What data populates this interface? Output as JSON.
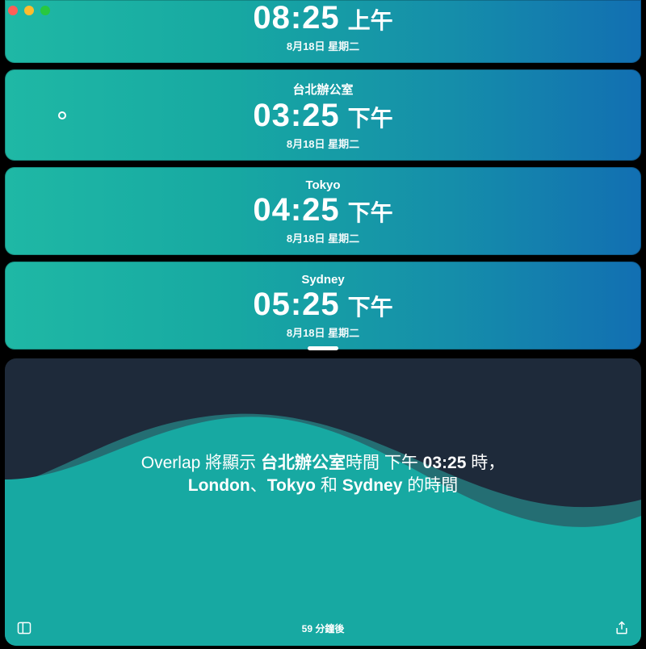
{
  "cards": [
    {
      "label": "",
      "time": "08:25",
      "ampm": "上午",
      "date": "8月18日 星期二",
      "cropped": true,
      "dot": false
    },
    {
      "label": "台北辦公室",
      "time": "03:25",
      "ampm": "下午",
      "date": "8月18日 星期二",
      "cropped": false,
      "dot": true
    },
    {
      "label": "Tokyo",
      "time": "04:25",
      "ampm": "下午",
      "date": "8月18日 星期二",
      "cropped": false,
      "dot": false
    },
    {
      "label": "Sydney",
      "time": "05:25",
      "ampm": "下午",
      "date": "8月18日 星期二",
      "cropped": false,
      "dot": false
    }
  ],
  "overlap": {
    "prefix": "Overlap 將顯示",
    "focus_city": "台北辦公室",
    "mid1": "時間 下午",
    "time": "03:25",
    "mid2": " 時，",
    "city1": "London",
    "sep1": "、",
    "city2": "Tokyo",
    "sep2": " 和 ",
    "city3": "Sydney",
    "tail": " 的時間"
  },
  "bottom": {
    "countdown": "59 分鐘後"
  },
  "colors": {
    "teal": "#17a9a2",
    "dark": "#1e2a3a"
  }
}
